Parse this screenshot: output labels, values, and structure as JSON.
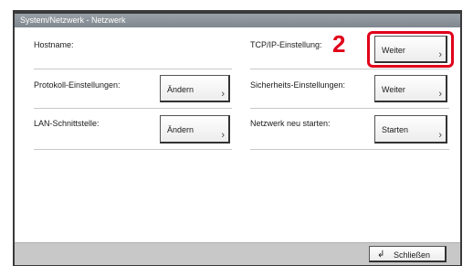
{
  "window": {
    "title": "System/Netzwerk - Netzwerk"
  },
  "step_marker": "2",
  "rows": {
    "hostname": {
      "label": "Hostname:"
    },
    "tcpip": {
      "label": "TCP/IP-Einstellung:",
      "button": "Weiter"
    },
    "protocol": {
      "label": "Protokoll-Einstellungen:",
      "button": "Ändern"
    },
    "security": {
      "label": "Sicherheits-Einstellungen:",
      "button": "Weiter"
    },
    "lan": {
      "label": "LAN-Schnittstelle:",
      "button": "Ändern"
    },
    "restart": {
      "label": "Netzwerk neu starten:",
      "button": "Starten"
    }
  },
  "footer": {
    "close_label": "Schließen",
    "close_icon": "return-arrow-icon"
  },
  "colors": {
    "highlight": "#e0001a",
    "titlebar": "#8a9199"
  }
}
